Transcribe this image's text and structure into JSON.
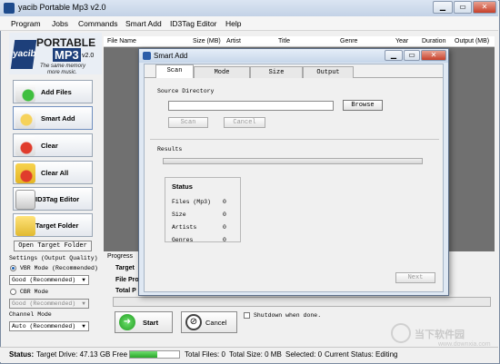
{
  "window": {
    "title": "yacib Portable Mp3 v2.0"
  },
  "menu": [
    "Program",
    "Jobs",
    "Commands",
    "Smart Add",
    "ID3Tag Editor",
    "Help"
  ],
  "logo": {
    "brand": "yacib",
    "title": "PORTABLE",
    "mp3": "MP3",
    "version": "v2.0",
    "tagline1": "The same memory",
    "tagline2": "more music."
  },
  "sidebar": {
    "buttons": [
      "Add Files",
      "Smart Add",
      "Clear",
      "Clear All",
      "ID3Tag Editor",
      "Target Folder"
    ],
    "open_target": "Open Target Folder",
    "settings_label": "Settings (Output Quality)",
    "vbr_label": "VBR Mode (Recommended)",
    "vbr_value": "Good (Recommended)",
    "cbr_label": "CBR Mode",
    "cbr_value": "Good (Recommended)",
    "channel_label": "Channel Mode",
    "channel_value": "Auto (Recommended)"
  },
  "list": {
    "columns": [
      "File Name",
      "Size (MB)",
      "Artist",
      "Title",
      "Genre",
      "Year",
      "Duration",
      "Output (MB)"
    ]
  },
  "progress": {
    "label": "Progress",
    "target_label": "Target",
    "file_label": "File Pro",
    "total_label": "Total P",
    "start": "Start",
    "cancel": "Cancel",
    "shutdown": "Shutdown when done."
  },
  "status": {
    "label": "Status:",
    "drive": "Target Drive: 47.13 GB Free",
    "files": "Total Files: 0",
    "size": "Total Size: 0 MB",
    "selected": "Selected: 0",
    "current": "Current Status: Editing",
    "drive_fill": 0.55
  },
  "dialog": {
    "title": "Smart Add",
    "tabs": [
      "Scan",
      "Mode",
      "Size",
      "Output"
    ],
    "source_label": "Source Directory",
    "browse": "Browse",
    "scan": "Scan",
    "cancel": "Cancel",
    "results_label": "Results",
    "status_label": "Status",
    "rows": [
      {
        "label": "Files (Mp3)",
        "value": "0"
      },
      {
        "label": "Size",
        "value": "0"
      },
      {
        "label": "Artists",
        "value": "0"
      },
      {
        "label": "Genres",
        "value": "0"
      }
    ],
    "next": "Next"
  },
  "watermark": {
    "text": "当下软件园",
    "url": "www.downxia.com"
  }
}
